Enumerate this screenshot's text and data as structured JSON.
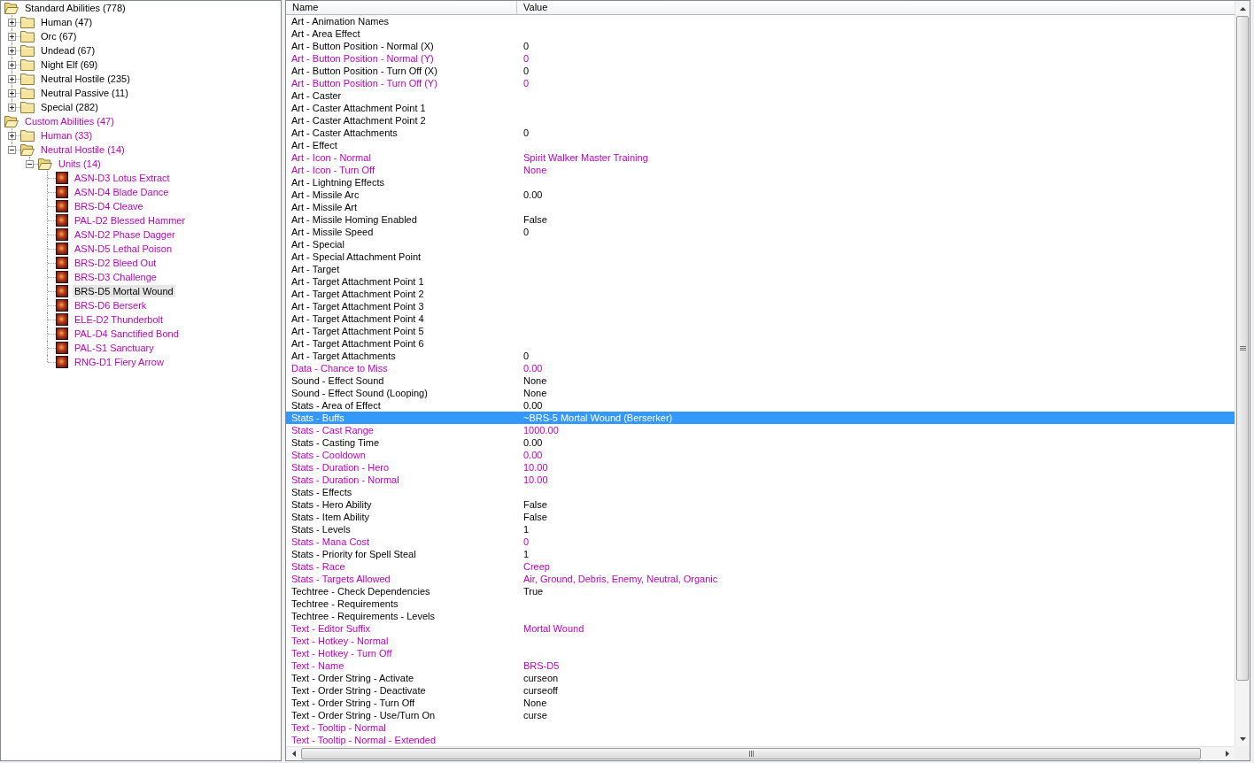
{
  "tree": [
    {
      "label": "Standard Abilities (778)",
      "kind": "folder",
      "modified": false,
      "expanded": true,
      "selected": false,
      "children": [
        {
          "label": "Human (47)",
          "kind": "folder",
          "modified": false,
          "expanded": false,
          "selected": false
        },
        {
          "label": "Orc (67)",
          "kind": "folder",
          "modified": false,
          "expanded": false,
          "selected": false
        },
        {
          "label": "Undead (67)",
          "kind": "folder",
          "modified": false,
          "expanded": false,
          "selected": false
        },
        {
          "label": "Night Elf (69)",
          "kind": "folder",
          "modified": false,
          "expanded": false,
          "selected": false
        },
        {
          "label": "Neutral Hostile (235)",
          "kind": "folder",
          "modified": false,
          "expanded": false,
          "selected": false
        },
        {
          "label": "Neutral Passive (11)",
          "kind": "folder",
          "modified": false,
          "expanded": false,
          "selected": false
        },
        {
          "label": "Special (282)",
          "kind": "folder",
          "modified": false,
          "expanded": false,
          "selected": false
        }
      ]
    },
    {
      "label": "Custom Abilities (47)",
      "kind": "folder",
      "modified": true,
      "expanded": true,
      "selected": false,
      "children": [
        {
          "label": "Human (33)",
          "kind": "folder",
          "modified": true,
          "expanded": false,
          "selected": false
        },
        {
          "label": "Neutral Hostile (14)",
          "kind": "folder",
          "modified": true,
          "expanded": true,
          "selected": false,
          "children": [
            {
              "label": "Units (14)",
              "kind": "folder",
              "modified": true,
              "expanded": true,
              "selected": false,
              "children": [
                {
                  "label": "ASN-D3 Lotus Extract",
                  "kind": "ability",
                  "modified": true,
                  "selected": false
                },
                {
                  "label": "ASN-D4 Blade Dance",
                  "kind": "ability",
                  "modified": true,
                  "selected": false
                },
                {
                  "label": "BRS-D4 Cleave",
                  "kind": "ability",
                  "modified": true,
                  "selected": false
                },
                {
                  "label": "PAL-D2 Blessed Hammer",
                  "kind": "ability",
                  "modified": true,
                  "selected": false
                },
                {
                  "label": "ASN-D2 Phase Dagger",
                  "kind": "ability",
                  "modified": true,
                  "selected": false
                },
                {
                  "label": "ASN-D5 Lethal Poison",
                  "kind": "ability",
                  "modified": true,
                  "selected": false
                },
                {
                  "label": "BRS-D2 Bleed Out",
                  "kind": "ability",
                  "modified": true,
                  "selected": false
                },
                {
                  "label": "BRS-D3 Challenge",
                  "kind": "ability",
                  "modified": true,
                  "selected": false
                },
                {
                  "label": "BRS-D5 Mortal Wound",
                  "kind": "ability",
                  "modified": false,
                  "selected": true
                },
                {
                  "label": "BRS-D6 Berserk",
                  "kind": "ability",
                  "modified": true,
                  "selected": false
                },
                {
                  "label": "ELE-D2 Thunderbolt",
                  "kind": "ability",
                  "modified": true,
                  "selected": false
                },
                {
                  "label": "PAL-D4 Sanctified Bond",
                  "kind": "ability",
                  "modified": true,
                  "selected": false
                },
                {
                  "label": "PAL-S1 Sanctuary",
                  "kind": "ability",
                  "modified": true,
                  "selected": false
                },
                {
                  "label": "RNG-D1 Fiery Arrow",
                  "kind": "ability",
                  "modified": true,
                  "selected": false
                }
              ]
            }
          ]
        }
      ]
    }
  ],
  "table": {
    "columns": [
      "Name",
      "Value"
    ],
    "rows": [
      {
        "name": "Art - Animation Names",
        "modified": false,
        "selected": false
      },
      {
        "name": "Art - Area Effect",
        "modified": false,
        "selected": false
      },
      {
        "name": "Art - Button Position - Normal (X)",
        "value": "0",
        "modified": false,
        "selected": false
      },
      {
        "name": "Art - Button Position - Normal (Y)",
        "value": "0",
        "modified": true,
        "selected": false
      },
      {
        "name": "Art - Button Position - Turn Off (X)",
        "value": "0",
        "modified": false,
        "selected": false
      },
      {
        "name": "Art - Button Position - Turn Off (Y)",
        "value": "0",
        "modified": true,
        "selected": false
      },
      {
        "name": "Art - Caster",
        "modified": false,
        "selected": false
      },
      {
        "name": "Art - Caster Attachment Point 1",
        "modified": false,
        "selected": false
      },
      {
        "name": "Art - Caster Attachment Point 2",
        "modified": false,
        "selected": false
      },
      {
        "name": "Art - Caster Attachments",
        "value": "0",
        "modified": false,
        "selected": false
      },
      {
        "name": "Art - Effect",
        "modified": false,
        "selected": false
      },
      {
        "name": "Art - Icon - Normal",
        "value": "Spirit Walker Master Training",
        "modified": true,
        "selected": false
      },
      {
        "name": "Art - Icon - Turn Off",
        "value": "None",
        "modified": true,
        "selected": false
      },
      {
        "name": "Art - Lightning Effects",
        "modified": false,
        "selected": false
      },
      {
        "name": "Art - Missile Arc",
        "value": "0.00",
        "modified": false,
        "selected": false
      },
      {
        "name": "Art - Missile Art",
        "modified": false,
        "selected": false
      },
      {
        "name": "Art - Missile Homing Enabled",
        "value": "False",
        "modified": false,
        "selected": false
      },
      {
        "name": "Art - Missile Speed",
        "value": "0",
        "modified": false,
        "selected": false
      },
      {
        "name": "Art - Special",
        "modified": false,
        "selected": false
      },
      {
        "name": "Art - Special Attachment Point",
        "modified": false,
        "selected": false
      },
      {
        "name": "Art - Target",
        "modified": false,
        "selected": false
      },
      {
        "name": "Art - Target Attachment Point 1",
        "modified": false,
        "selected": false
      },
      {
        "name": "Art - Target Attachment Point 2",
        "modified": false,
        "selected": false
      },
      {
        "name": "Art - Target Attachment Point 3",
        "modified": false,
        "selected": false
      },
      {
        "name": "Art - Target Attachment Point 4",
        "modified": false,
        "selected": false
      },
      {
        "name": "Art - Target Attachment Point 5",
        "modified": false,
        "selected": false
      },
      {
        "name": "Art - Target Attachment Point 6",
        "modified": false,
        "selected": false
      },
      {
        "name": "Art - Target Attachments",
        "value": "0",
        "modified": false,
        "selected": false
      },
      {
        "name": "Data - Chance to Miss",
        "value": "0.00",
        "modified": true,
        "selected": false
      },
      {
        "name": "Sound - Effect Sound",
        "value": "None",
        "modified": false,
        "selected": false
      },
      {
        "name": "Sound - Effect Sound (Looping)",
        "value": "None",
        "modified": false,
        "selected": false
      },
      {
        "name": "Stats - Area of Effect",
        "value": "0.00",
        "modified": false,
        "selected": false
      },
      {
        "name": "Stats - Buffs",
        "value": "~BRS-5 Mortal Wound (Berserker)",
        "modified": false,
        "selected": true
      },
      {
        "name": "Stats - Cast Range",
        "value": "1000.00",
        "modified": true,
        "selected": false
      },
      {
        "name": "Stats - Casting Time",
        "value": "0.00",
        "modified": false,
        "selected": false
      },
      {
        "name": "Stats - Cooldown",
        "value": "0.00",
        "modified": true,
        "selected": false
      },
      {
        "name": "Stats - Duration - Hero",
        "value": "10.00",
        "modified": true,
        "selected": false
      },
      {
        "name": "Stats - Duration - Normal",
        "value": "10.00",
        "modified": true,
        "selected": false
      },
      {
        "name": "Stats - Effects",
        "modified": false,
        "selected": false
      },
      {
        "name": "Stats - Hero Ability",
        "value": "False",
        "modified": false,
        "selected": false
      },
      {
        "name": "Stats - Item Ability",
        "value": "False",
        "modified": false,
        "selected": false
      },
      {
        "name": "Stats - Levels",
        "value": "1",
        "modified": false,
        "selected": false
      },
      {
        "name": "Stats - Mana Cost",
        "value": "0",
        "modified": true,
        "selected": false
      },
      {
        "name": "Stats - Priority for Spell Steal",
        "value": "1",
        "modified": false,
        "selected": false
      },
      {
        "name": "Stats - Race",
        "value": "Creep",
        "modified": true,
        "selected": false
      },
      {
        "name": "Stats - Targets Allowed",
        "value": "Air, Ground, Debris, Enemy, Neutral, Organic",
        "modified": true,
        "selected": false
      },
      {
        "name": "Techtree - Check Dependencies",
        "value": "True",
        "modified": false,
        "selected": false
      },
      {
        "name": "Techtree - Requirements",
        "modified": false,
        "selected": false
      },
      {
        "name": "Techtree - Requirements - Levels",
        "modified": false,
        "selected": false
      },
      {
        "name": "Text - Editor Suffix",
        "value": "Mortal Wound",
        "modified": true,
        "selected": false
      },
      {
        "name": "Text - Hotkey - Normal",
        "modified": true,
        "selected": false
      },
      {
        "name": "Text - Hotkey - Turn Off",
        "modified": true,
        "selected": false
      },
      {
        "name": "Text - Name",
        "value": "BRS-D5",
        "modified": true,
        "selected": false
      },
      {
        "name": "Text - Order String - Activate",
        "value": "curseon",
        "modified": false,
        "selected": false
      },
      {
        "name": "Text - Order String - Deactivate",
        "value": "curseoff",
        "modified": false,
        "selected": false
      },
      {
        "name": "Text - Order String - Turn Off",
        "value": "None",
        "modified": false,
        "selected": false
      },
      {
        "name": "Text - Order String - Use/Turn On",
        "value": "curse",
        "modified": false,
        "selected": false
      },
      {
        "name": "Text - Tooltip - Normal",
        "modified": true,
        "selected": false
      },
      {
        "name": "Text - Tooltip - Normal - Extended",
        "modified": true,
        "selected": false
      }
    ]
  }
}
